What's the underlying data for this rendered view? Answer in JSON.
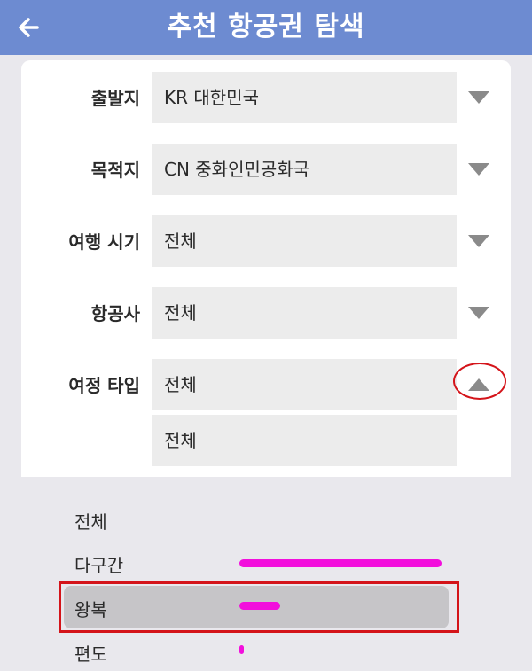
{
  "header": {
    "title": "추천 항공권 탐색",
    "background_color": "#6d8bd1"
  },
  "form": {
    "departure": {
      "label": "출발지",
      "value": "KR 대한민국"
    },
    "destination": {
      "label": "목적지",
      "value": "CN 중화인민공화국"
    },
    "travel_period": {
      "label": "여행 시기",
      "value": "전체"
    },
    "airline": {
      "label": "항공사",
      "value": "전체"
    },
    "trip_type": {
      "label": "여정 타입",
      "value": "전체",
      "secondary_value": "전체",
      "expanded": true
    }
  },
  "trip_type_options": [
    {
      "label": "전체"
    },
    {
      "label": "다구간"
    },
    {
      "label": "왕복",
      "selected": true
    },
    {
      "label": "편도"
    }
  ],
  "colors": {
    "annotation_red": "#d4141a",
    "highlighter_magenta": "#f20fdc",
    "chevron_gray": "#8a8a8a"
  }
}
